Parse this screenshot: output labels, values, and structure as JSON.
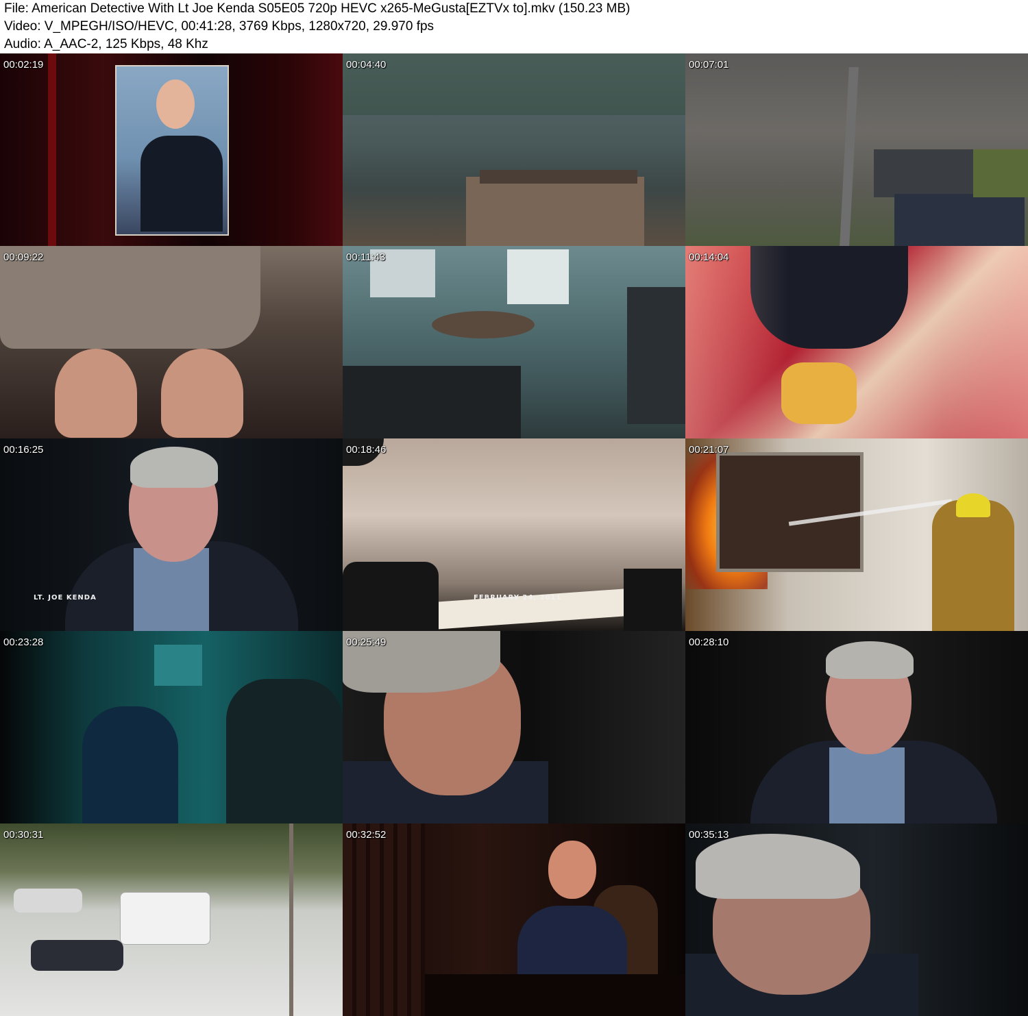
{
  "header": {
    "file_line": "File: American Detective With Lt Joe Kenda S05E05 720p HEVC x265-MeGusta[EZTVx to].mkv (150.23 MB)",
    "video_line": "Video: V_MPEGH/ISO/HEVC, 00:41:28, 3769 Kbps, 1280x720, 29.970 fps",
    "audio_line": "Audio: A_AAC-2, 125 Kbps, 48 Khz"
  },
  "thumbnails": [
    {
      "time": "00:02:19",
      "caption": ""
    },
    {
      "time": "00:04:40",
      "caption": ""
    },
    {
      "time": "00:07:01",
      "caption": ""
    },
    {
      "time": "00:09:22",
      "caption": ""
    },
    {
      "time": "00:11:43",
      "caption": ""
    },
    {
      "time": "00:14:04",
      "caption": ""
    },
    {
      "time": "00:16:25",
      "caption": "LT. JOE KENDA"
    },
    {
      "time": "00:18:46",
      "caption": "FEBRUARY 24, 2011"
    },
    {
      "time": "00:21:07",
      "caption": ""
    },
    {
      "time": "00:23:28",
      "caption": ""
    },
    {
      "time": "00:25:49",
      "caption": ""
    },
    {
      "time": "00:28:10",
      "caption": ""
    },
    {
      "time": "00:30:31",
      "caption": ""
    },
    {
      "time": "00:32:52",
      "caption": ""
    },
    {
      "time": "00:35:13",
      "caption": ""
    }
  ]
}
